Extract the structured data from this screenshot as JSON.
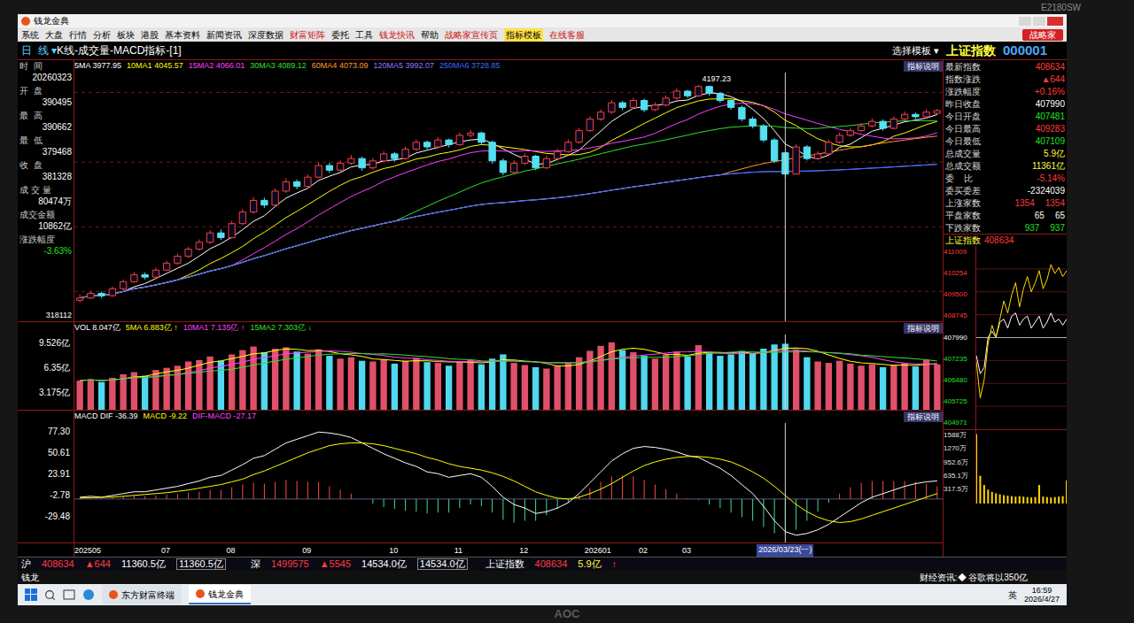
{
  "monitor": {
    "model": "E2180SW",
    "brand": "AOC"
  },
  "window": {
    "title": "钱龙金典"
  },
  "menu": [
    {
      "label": "系统",
      "color": "#000000",
      "selected": false
    },
    {
      "label": "大盘",
      "color": "#000000",
      "selected": false
    },
    {
      "label": "行情",
      "color": "#000000",
      "selected": false
    },
    {
      "label": "分析",
      "color": "#000000",
      "selected": false
    },
    {
      "label": "板块",
      "color": "#000000",
      "selected": false
    },
    {
      "label": "港股",
      "color": "#000000",
      "selected": false
    },
    {
      "label": "基本资料",
      "color": "#000000",
      "selected": false
    },
    {
      "label": "新闻资讯",
      "color": "#000000",
      "selected": false
    },
    {
      "label": "深度数据",
      "color": "#000000",
      "selected": false
    },
    {
      "label": "财富矩阵",
      "color": "#d01010",
      "selected": false
    },
    {
      "label": "委托",
      "color": "#000000",
      "selected": false
    },
    {
      "label": "工具",
      "color": "#000000",
      "selected": false
    },
    {
      "label": "钱龙快讯",
      "color": "#d01010",
      "selected": false
    },
    {
      "label": "帮助",
      "color": "#000000",
      "selected": false
    },
    {
      "label": "战略家宣传页",
      "color": "#d01010",
      "selected": false
    },
    {
      "label": "指标模板",
      "color": "#000000",
      "selected": true
    },
    {
      "label": "在线客服",
      "color": "#d01010",
      "selected": false
    }
  ],
  "menu_button": "战略家",
  "header": {
    "period": "日  线",
    "arrow": "▾",
    "indicator": "K线-成交量-MACD指标-[1]",
    "template": "选择模板",
    "template_arrow": "▾"
  },
  "info_panel": {
    "items": [
      {
        "label": "时  间",
        "value": "20260323",
        "color": "#ffffff"
      },
      {
        "label": "开  盘",
        "value": "390495",
        "color": "#ffffff"
      },
      {
        "label": "最  高",
        "value": "390662",
        "color": "#ffffff"
      },
      {
        "label": "最  低",
        "value": "379468",
        "color": "#ffffff"
      },
      {
        "label": "收  盘",
        "value": "381328",
        "color": "#ffffff"
      },
      {
        "label": "成 交 量",
        "value": "80474万",
        "color": "#ffffff"
      },
      {
        "label": "成交金额",
        "value": "10862亿",
        "color": "#ffffff"
      },
      {
        "label": "涨跌幅度",
        "value": "-3.63%",
        "color": "#22e022"
      }
    ],
    "axis_min": "318112"
  },
  "price_chart": {
    "legend": [
      {
        "label": "5MA",
        "value": "3977.95",
        "color": "#ffffff",
        "period": 5
      },
      {
        "label": "10MA1",
        "value": "4045.57",
        "color": "#ffff00",
        "period": 10
      },
      {
        "label": "15MA2",
        "value": "4066.01",
        "color": "#ff40ff",
        "period": 15
      },
      {
        "label": "30MA3",
        "value": "4089.12",
        "color": "#30e030",
        "period": 30
      },
      {
        "label": "60MA4",
        "value": "4073.09",
        "color": "#ff9933",
        "period": 60
      },
      {
        "label": "120MA5",
        "value": "3992.07",
        "color": "#8a7cff",
        "period": 120
      },
      {
        "label": "250MA6",
        "value": "3728.85",
        "color": "#3a6cff",
        "period": 250
      }
    ],
    "note": "指标说明",
    "peak_label": "4197.23",
    "min": 3180,
    "max": 4250,
    "cursor_index": 65,
    "candles": [
      [
        3270,
        3295,
        3262,
        3280
      ],
      [
        3280,
        3310,
        3275,
        3300
      ],
      [
        3300,
        3308,
        3280,
        3290
      ],
      [
        3290,
        3330,
        3285,
        3320
      ],
      [
        3320,
        3360,
        3312,
        3350
      ],
      [
        3350,
        3392,
        3345,
        3380
      ],
      [
        3380,
        3390,
        3360,
        3370
      ],
      [
        3370,
        3410,
        3365,
        3400
      ],
      [
        3400,
        3440,
        3395,
        3430
      ],
      [
        3430,
        3470,
        3422,
        3460
      ],
      [
        3460,
        3500,
        3452,
        3490
      ],
      [
        3490,
        3532,
        3484,
        3520
      ],
      [
        3520,
        3572,
        3512,
        3560
      ],
      [
        3560,
        3575,
        3530,
        3540
      ],
      [
        3540,
        3612,
        3535,
        3600
      ],
      [
        3600,
        3662,
        3594,
        3650
      ],
      [
        3650,
        3715,
        3642,
        3700
      ],
      [
        3700,
        3712,
        3668,
        3680
      ],
      [
        3680,
        3752,
        3676,
        3740
      ],
      [
        3740,
        3795,
        3733,
        3780
      ],
      [
        3780,
        3790,
        3748,
        3760
      ],
      [
        3760,
        3812,
        3752,
        3800
      ],
      [
        3800,
        3865,
        3795,
        3850
      ],
      [
        3850,
        3862,
        3818,
        3830
      ],
      [
        3830,
        3872,
        3822,
        3860
      ],
      [
        3860,
        3895,
        3852,
        3880
      ],
      [
        3880,
        3888,
        3828,
        3840
      ],
      [
        3840,
        3882,
        3832,
        3870
      ],
      [
        3870,
        3912,
        3862,
        3900
      ],
      [
        3900,
        3908,
        3868,
        3880
      ],
      [
        3880,
        3932,
        3874,
        3920
      ],
      [
        3920,
        3962,
        3912,
        3950
      ],
      [
        3950,
        3958,
        3920,
        3930
      ],
      [
        3930,
        3972,
        3924,
        3960
      ],
      [
        3960,
        3966,
        3928,
        3940
      ],
      [
        3940,
        3992,
        3934,
        3980
      ],
      [
        3980,
        4002,
        3970,
        3990
      ],
      [
        3990,
        3996,
        3940,
        3950
      ],
      [
        3950,
        3958,
        3858,
        3870
      ],
      [
        3870,
        3880,
        3808,
        3820
      ],
      [
        3820,
        3872,
        3814,
        3860
      ],
      [
        3860,
        3902,
        3852,
        3890
      ],
      [
        3890,
        3896,
        3830,
        3840
      ],
      [
        3840,
        3892,
        3834,
        3880
      ],
      [
        3880,
        3922,
        3872,
        3910
      ],
      [
        3910,
        3962,
        3904,
        3950
      ],
      [
        3950,
        4012,
        3944,
        4000
      ],
      [
        4000,
        4062,
        3994,
        4050
      ],
      [
        4050,
        4092,
        4042,
        4080
      ],
      [
        4080,
        4132,
        4072,
        4120
      ],
      [
        4120,
        4128,
        4088,
        4100
      ],
      [
        4100,
        4142,
        4094,
        4130
      ],
      [
        4130,
        4138,
        4080,
        4090
      ],
      [
        4090,
        4122,
        4084,
        4110
      ],
      [
        4110,
        4152,
        4104,
        4140
      ],
      [
        4140,
        4182,
        4134,
        4170
      ],
      [
        4170,
        4176,
        4140,
        4150
      ],
      [
        4150,
        4197.23,
        4144,
        4190
      ],
      [
        4190,
        4194,
        4150,
        4160
      ],
      [
        4160,
        4166,
        4120,
        4130
      ],
      [
        4130,
        4136,
        4090,
        4100
      ],
      [
        4100,
        4108,
        4040,
        4050
      ],
      [
        4050,
        4060,
        4010,
        4020
      ],
      [
        4020,
        4028,
        3950,
        3960
      ],
      [
        3960,
        3968,
        3860,
        3870
      ],
      [
        3904.95,
        3906.62,
        3794.68,
        3813.28
      ],
      [
        3813.28,
        3942,
        3810,
        3930
      ],
      [
        3930,
        3938,
        3872,
        3880
      ],
      [
        3880,
        3912,
        3874,
        3900
      ],
      [
        3900,
        3962,
        3894,
        3950
      ],
      [
        3950,
        3992,
        3944,
        3980
      ],
      [
        3980,
        4012,
        3974,
        4000
      ],
      [
        4000,
        4032,
        3994,
        4020
      ],
      [
        4020,
        4052,
        4014,
        4040
      ],
      [
        4040,
        4048,
        4000,
        4010
      ],
      [
        4010,
        4062,
        4004,
        4050
      ],
      [
        4050,
        4082,
        4044,
        4070
      ],
      [
        4070,
        4078,
        4050,
        4060
      ],
      [
        4060,
        4092,
        4054,
        4080
      ],
      [
        4074.81,
        4092.83,
        4071.09,
        4086.34
      ]
    ]
  },
  "volume_chart": {
    "legend": [
      {
        "label": "VOL",
        "value": "8.047亿",
        "arrow": "",
        "color": "#ffffff",
        "period": 0
      },
      {
        "label": "5MA",
        "value": "6.883亿",
        "arrow": "↑",
        "color": "#ffff00",
        "period": 5
      },
      {
        "label": "10MA1",
        "value": "7.135亿",
        "arrow": "↑",
        "color": "#ff40ff",
        "period": 10
      },
      {
        "label": "15MA2",
        "value": "7.303亿",
        "arrow": "↓",
        "color": "#30e030",
        "period": 15
      }
    ],
    "note": "指标说明",
    "ticks": [
      "9.526亿",
      "6.35亿",
      "3.175亿"
    ],
    "max": 10.6,
    "values": [
      4.1,
      4.3,
      3.9,
      4.5,
      5.0,
      5.3,
      4.8,
      5.6,
      5.9,
      6.2,
      6.8,
      7.0,
      7.5,
      6.9,
      7.8,
      8.4,
      8.9,
      8.1,
      8.6,
      8.8,
      8.2,
      7.9,
      8.5,
      7.6,
      7.2,
      7.4,
      6.9,
      6.8,
      7.1,
      6.5,
      6.9,
      7.3,
      6.7,
      6.6,
      6.2,
      6.8,
      7.0,
      6.4,
      7.2,
      7.8,
      6.6,
      6.3,
      6.0,
      5.8,
      6.2,
      6.6,
      7.4,
      8.3,
      9.0,
      9.5,
      8.4,
      8.1,
      7.6,
      7.2,
      7.8,
      8.2,
      7.5,
      9.1,
      8.0,
      7.6,
      7.8,
      8.3,
      7.9,
      8.6,
      9.2,
      9.3,
      8.5,
      7.4,
      6.8,
      6.6,
      6.9,
      6.5,
      6.2,
      6.4,
      6.0,
      6.3,
      6.6,
      6.1,
      7.0,
      6.4
    ]
  },
  "macd_chart": {
    "legend": [
      {
        "label": "MACD DIF",
        "value": "-36.39",
        "color": "#ffffff"
      },
      {
        "label": "MACD",
        "value": "-9.22",
        "color": "#ffff00"
      },
      {
        "label": "DIF-MACD",
        "value": "-27.17",
        "color": "#ff40ff"
      }
    ],
    "note": "指标说明",
    "ticks": [
      "77.30",
      "50.61",
      "23.91",
      "-2.78",
      "-29.48"
    ],
    "min": -48,
    "max": 84,
    "dif": [
      2,
      3,
      2,
      4,
      6,
      8,
      8,
      10,
      12,
      14,
      17,
      20,
      24,
      26,
      32,
      38,
      45,
      48,
      55,
      62,
      66,
      70,
      74,
      73,
      71,
      68,
      62,
      56,
      50,
      45,
      40,
      36,
      30,
      28,
      24,
      26,
      28,
      24,
      14,
      2,
      -6,
      -10,
      -16,
      -14,
      -10,
      -4,
      6,
      18,
      30,
      42,
      50,
      56,
      58,
      57,
      55,
      52,
      48,
      46,
      40,
      34,
      26,
      16,
      6,
      -8,
      -24,
      -36,
      -40,
      -38,
      -34,
      -28,
      -20,
      -12,
      -4,
      2,
      6,
      10,
      14,
      17,
      19,
      20
    ],
    "dea": [
      1,
      1.5,
      1.8,
      2.2,
      3,
      4,
      5,
      6,
      7,
      8.5,
      10,
      12,
      14,
      16,
      19,
      22,
      27,
      31,
      36,
      41,
      46,
      51,
      55,
      59,
      61,
      62,
      62,
      61,
      59,
      56,
      53,
      50,
      46,
      43,
      39,
      36,
      34,
      32,
      29,
      25,
      20,
      14,
      8,
      4,
      1,
      0,
      2,
      6,
      11,
      17,
      24,
      31,
      37,
      41,
      44,
      46,
      47,
      47,
      46,
      44,
      41,
      36,
      30,
      23,
      14,
      4,
      -6,
      -14,
      -20,
      -24,
      -26,
      -25,
      -22,
      -18,
      -14,
      -10,
      -6,
      -2,
      2,
      6
    ]
  },
  "x_axis": {
    "labels": [
      {
        "label": "202505",
        "at": 0
      },
      {
        "label": "07",
        "at": 8
      },
      {
        "label": "08",
        "at": 14
      },
      {
        "label": "09",
        "at": 21
      },
      {
        "label": "10",
        "at": 29
      },
      {
        "label": "11",
        "at": 35
      },
      {
        "label": "12",
        "at": 41
      },
      {
        "label": "202601",
        "at": 47
      },
      {
        "label": "02",
        "at": 52
      },
      {
        "label": "03",
        "at": 56
      }
    ],
    "cursor_label": "2026/03/23(一)"
  },
  "right_panel": {
    "name": "上证指数",
    "code": "000001",
    "rows": [
      {
        "label": "最新指数",
        "values": [
          "408634"
        ],
        "color": "#ff3b3b"
      },
      {
        "label": "指数涨跌",
        "values": [
          "▲644"
        ],
        "color": "#ff3b3b"
      },
      {
        "label": "涨跌幅度",
        "values": [
          "+0.16%"
        ],
        "color": "#ff3b3b"
      },
      {
        "label": "昨日收盘",
        "values": [
          "407990"
        ],
        "color": "#ffffff"
      },
      {
        "label": "今日开盘",
        "values": [
          "407481"
        ],
        "color": "#22e022"
      },
      {
        "label": "今日最高",
        "values": [
          "409283"
        ],
        "color": "#ff3b3b"
      },
      {
        "label": "今日最低",
        "values": [
          "407109"
        ],
        "color": "#22e022"
      },
      {
        "label": "总成交量",
        "values": [
          "5.9亿"
        ],
        "color": "#ffff40"
      },
      {
        "label": "总成交额",
        "values": [
          "11361亿"
        ],
        "color": "#ffff40"
      },
      {
        "label": "委    比",
        "values": [
          "-5.14%"
        ],
        "color": "#ff3b3b"
      },
      {
        "label": "委买委差",
        "values": [
          "-2324039"
        ],
        "color": "#ffffff"
      },
      {
        "label": "上涨家数",
        "values": [
          "1354",
          "1354"
        ],
        "color": "#ff3b3b"
      },
      {
        "label": "平盘家数",
        "values": [
          "65",
          "65"
        ],
        "color": "#ffffff"
      },
      {
        "label": "下跌家数",
        "values": [
          "937",
          "937"
        ],
        "color": "#22e022"
      }
    ],
    "mini_chart": {
      "title": "上证指数",
      "value": "408634",
      "price_ticks": [
        {
          "label": "411009",
          "color": "#ff3b3b"
        },
        {
          "label": "410254",
          "color": "#ff3b3b"
        },
        {
          "label": "409500",
          "color": "#ff3b3b"
        },
        {
          "label": "408745",
          "color": "#ff3b3b"
        },
        {
          "label": "407990",
          "color": "#ffffff"
        },
        {
          "label": "407235",
          "color": "#22e022"
        },
        {
          "label": "406480",
          "color": "#22e022"
        },
        {
          "label": "405725",
          "color": "#22e022"
        },
        {
          "label": "404971",
          "color": "#22e022"
        }
      ],
      "volume_ticks": [
        "1588万",
        "1270万",
        "952.6万",
        "635.1万",
        "317.5万"
      ],
      "min": 4049.71,
      "max": 4110.09,
      "prev_close": 4079.9,
      "vol_max": 1588,
      "price": [
        4072,
        4060,
        4066,
        4078,
        4084,
        4080,
        4086,
        4092,
        4088,
        4094,
        4098,
        4090,
        4096,
        4100,
        4095,
        4098,
        4102,
        4096,
        4099,
        4104,
        4101,
        4103,
        4100,
        4102
      ],
      "avg": [
        4074,
        4068,
        4070,
        4080,
        4082,
        4080,
        4085,
        4086,
        4083,
        4087,
        4088,
        4084,
        4086,
        4087,
        4083,
        4085,
        4087,
        4083,
        4085,
        4088,
        4085,
        4086,
        4084,
        4086
      ],
      "volume": [
        1500,
        600,
        400,
        300,
        250,
        220,
        200,
        180,
        170,
        160,
        150,
        160,
        150,
        140,
        130,
        140,
        400,
        150,
        140,
        130,
        140,
        150,
        160,
        500
      ]
    }
  },
  "quote_bar": {
    "sh": {
      "label": "沪",
      "value": "408634",
      "change": "▲644",
      "amount": "11360.5亿",
      "amount_box": "11360.5亿"
    },
    "sz": {
      "label": "深",
      "value": "1499575",
      "change": "▲5545",
      "amount": "14534.0亿",
      "amount_box": "14534.0亿"
    },
    "index": {
      "label": "上证指数",
      "value": "408634",
      "volume": "5.9亿",
      "arrow": "↑"
    }
  },
  "news_bar": {
    "brand": "钱龙",
    "text": "财经资讯:◆ 谷歌将以350亿"
  },
  "taskbar": {
    "apps": [
      {
        "label": "东方财富终端",
        "selected": false
      },
      {
        "label": "钱龙金典",
        "selected": true
      }
    ],
    "ime": "英",
    "time": "16:59",
    "date": "2026/4/27"
  }
}
